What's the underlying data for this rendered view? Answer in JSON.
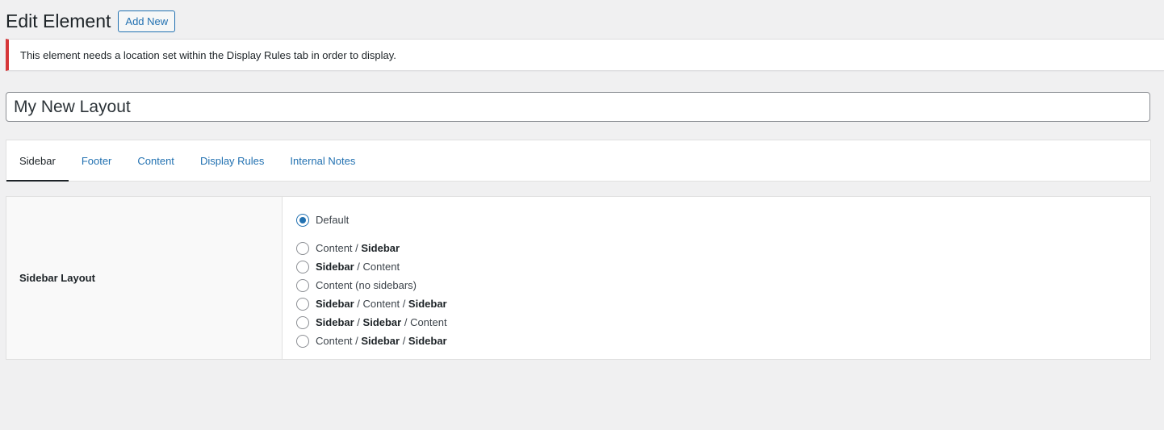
{
  "header": {
    "title": "Edit Element",
    "add_new_label": "Add New"
  },
  "notice": {
    "text": "This element needs a location set within the Display Rules tab in order to display."
  },
  "title_field": {
    "value": "My New Layout"
  },
  "tabs": [
    {
      "label": "Sidebar",
      "active": true
    },
    {
      "label": "Footer",
      "active": false
    },
    {
      "label": "Content",
      "active": false
    },
    {
      "label": "Display Rules",
      "active": false
    },
    {
      "label": "Internal Notes",
      "active": false
    }
  ],
  "sidebar_layout": {
    "label": "Sidebar Layout",
    "selected_index": 0,
    "options": [
      {
        "parts": [
          [
            "Default",
            false
          ]
        ]
      },
      {
        "parts": [
          [
            "Content",
            false
          ],
          [
            " / ",
            false
          ],
          [
            "Sidebar",
            true
          ]
        ]
      },
      {
        "parts": [
          [
            "Sidebar",
            true
          ],
          [
            " / ",
            false
          ],
          [
            "Content",
            false
          ]
        ]
      },
      {
        "parts": [
          [
            "Content (no sidebars)",
            false
          ]
        ]
      },
      {
        "parts": [
          [
            "Sidebar",
            true
          ],
          [
            " / ",
            false
          ],
          [
            "Content",
            false
          ],
          [
            " / ",
            false
          ],
          [
            "Sidebar",
            true
          ]
        ]
      },
      {
        "parts": [
          [
            "Sidebar",
            true
          ],
          [
            " / ",
            false
          ],
          [
            "Sidebar",
            true
          ],
          [
            " / ",
            false
          ],
          [
            "Content",
            false
          ]
        ]
      },
      {
        "parts": [
          [
            "Content",
            false
          ],
          [
            " / ",
            false
          ],
          [
            "Sidebar",
            true
          ],
          [
            " / ",
            false
          ],
          [
            "Sidebar",
            true
          ]
        ]
      }
    ]
  },
  "colors": {
    "accent": "#2271b1",
    "notice_error": "#d63638",
    "background": "#f0f0f1"
  }
}
